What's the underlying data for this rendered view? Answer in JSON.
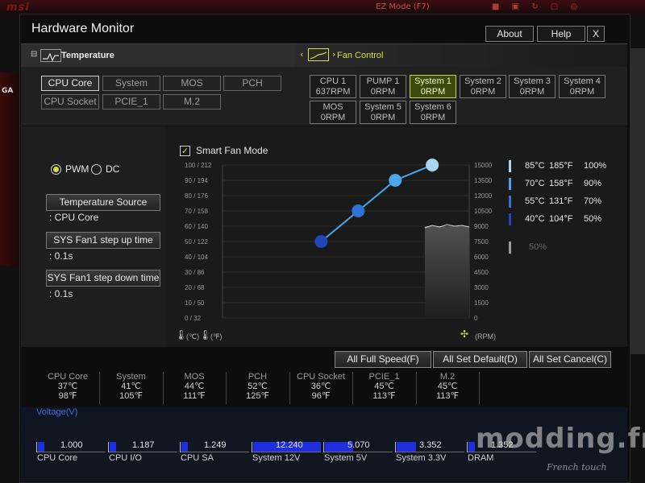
{
  "background": {
    "logo": "msi",
    "ez_mode": "EZ Mode (F7)",
    "side_tag": "GA"
  },
  "window": {
    "title": "Hardware Monitor",
    "buttons": {
      "about": "About",
      "help": "Help",
      "close": "X"
    }
  },
  "temperature_panel": {
    "header": "Temperature",
    "sources": [
      "CPU Core",
      "System",
      "MOS",
      "PCH",
      "CPU Socket",
      "PCIE_1",
      "M.2"
    ],
    "selected": "CPU Core"
  },
  "fan_panel": {
    "header": "Fan Control",
    "fans": [
      {
        "name": "CPU 1",
        "rpm": "637RPM"
      },
      {
        "name": "PUMP 1",
        "rpm": "0RPM"
      },
      {
        "name": "System 1",
        "rpm": "0RPM"
      },
      {
        "name": "System 2",
        "rpm": "0RPM"
      },
      {
        "name": "System 3",
        "rpm": "0RPM"
      },
      {
        "name": "System 4",
        "rpm": "0RPM"
      },
      {
        "name": "MOS",
        "rpm": "0RPM"
      },
      {
        "name": "System 5",
        "rpm": "0RPM"
      },
      {
        "name": "System 6",
        "rpm": "0RPM"
      }
    ],
    "selected": "System 1"
  },
  "fan_settings": {
    "mode_pwm": "PWM",
    "mode_dc": "DC",
    "temp_source_btn": "Temperature Source",
    "temp_source_val": ": CPU Core",
    "step_up_btn": "SYS Fan1 step up time",
    "step_up_val": ": 0.1s",
    "step_down_btn": "SYS Fan1 step down time",
    "step_down_val": ": 0.1s"
  },
  "smart_fan": {
    "label": "Smart Fan Mode",
    "left_ticks": [
      "100 / 212",
      "90 / 194",
      "80 / 176",
      "70 / 158",
      "60 / 140",
      "50 / 122",
      "40 / 104",
      "30 /  86",
      "20 /  68",
      "10 /  50",
      "0 /  32"
    ],
    "right_ticks": [
      "15000",
      "13500",
      "12000",
      "10500",
      "9000",
      "7500",
      "6000",
      "4500",
      "3000",
      "1500",
      "0"
    ],
    "unit_c": "(℃)",
    "unit_f": "(℉)",
    "unit_rpm": "(RPM)",
    "legend": [
      {
        "c": "85°C",
        "f": "185°F",
        "pct": "100%",
        "color": "#a8d8f0"
      },
      {
        "c": "70°C",
        "f": "158°F",
        "pct": "90%",
        "color": "#4aa6e8"
      },
      {
        "c": "55°C",
        "f": "131°F",
        "pct": "70%",
        "color": "#2e72d6"
      },
      {
        "c": "40°C",
        "f": "104°F",
        "pct": "50%",
        "color": "#2246b8"
      }
    ],
    "stop_pct": "50%"
  },
  "chart_data": {
    "type": "line",
    "x": [
      40,
      55,
      70,
      85
    ],
    "y": [
      50,
      70,
      90,
      100
    ],
    "x_range": [
      0,
      100
    ],
    "y_range": [
      0,
      100
    ],
    "background_area_top": 60
  },
  "actions": {
    "full_speed": "All Full Speed(F)",
    "set_default": "All Set Default(D)",
    "set_cancel": "All Set Cancel(C)"
  },
  "temps": [
    {
      "name": "CPU Core",
      "c": "37℃",
      "f": "98℉"
    },
    {
      "name": "System",
      "c": "41℃",
      "f": "105℉"
    },
    {
      "name": "MOS",
      "c": "44℃",
      "f": "111℉"
    },
    {
      "name": "PCH",
      "c": "52℃",
      "f": "125℉"
    },
    {
      "name": "CPU Socket",
      "c": "36℃",
      "f": "96℉"
    },
    {
      "name": "PCIE_1",
      "c": "45℃",
      "f": "113℉"
    },
    {
      "name": "M.2",
      "c": "45℃",
      "f": "113℉"
    }
  ],
  "voltage": {
    "label": "Voltage(V)",
    "items": [
      {
        "name": "CPU Core",
        "value": "1.000",
        "fill": 0.1
      },
      {
        "name": "CPU I/O",
        "value": "1.187",
        "fill": 0.1
      },
      {
        "name": "CPU SA",
        "value": "1.249",
        "fill": 0.1
      },
      {
        "name": "System 12V",
        "value": "12.240",
        "fill": 1.0
      },
      {
        "name": "System 5V",
        "value": "5.070",
        "fill": 0.42
      },
      {
        "name": "System 3.3V",
        "value": "3.352",
        "fill": 0.28
      },
      {
        "name": "DRAM",
        "value": "1.352",
        "fill": 0.1
      }
    ]
  },
  "watermark": {
    "main": "modding.fr",
    "sub": "French touch"
  }
}
